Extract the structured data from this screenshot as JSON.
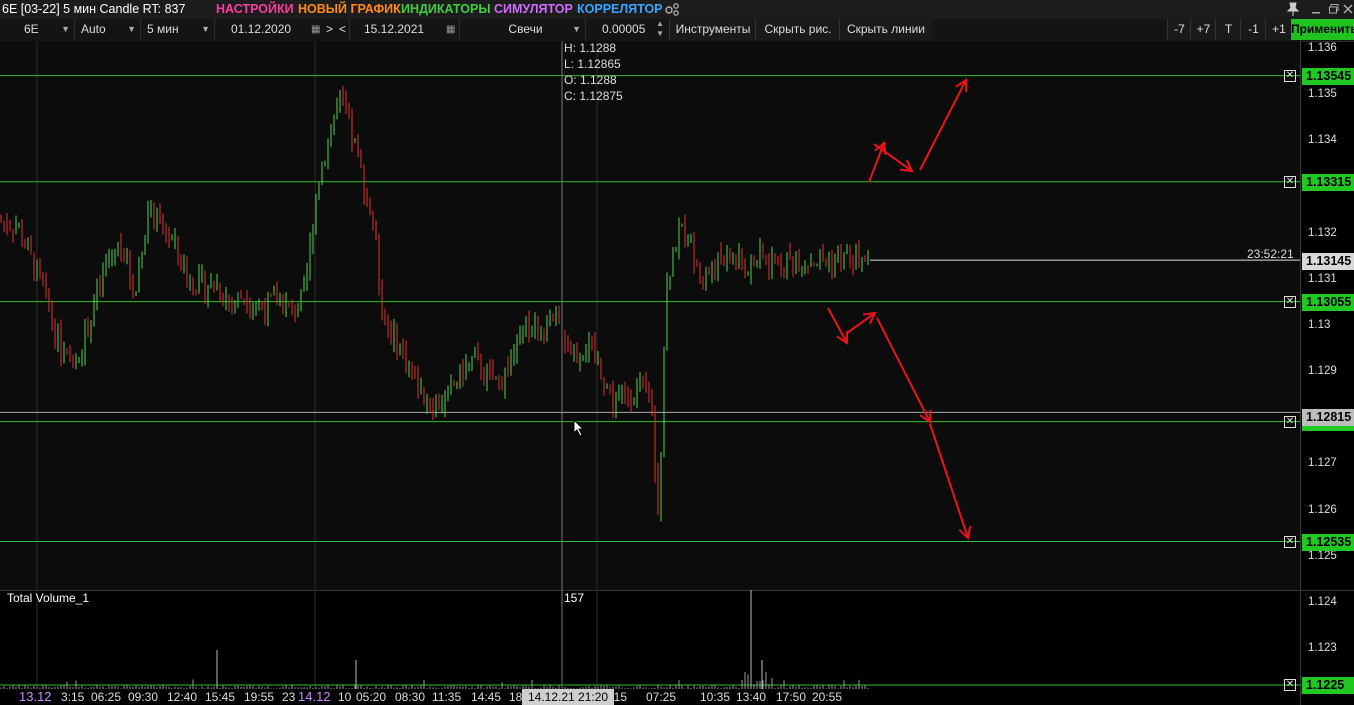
{
  "titlebar": {
    "title": "6E [03-22] 5 мин Candle RT: 837",
    "menu": [
      {
        "label": "НАСТРОЙКИ",
        "color": "#ff3aa0"
      },
      {
        "label": "НОВЫЙ ГРАФИК",
        "color": "#ff8a1a"
      },
      {
        "label": "ИНДИКАТОРЫ",
        "color": "#3ecf3e"
      },
      {
        "label": "СИМУЛЯТОР",
        "color": "#d06bff"
      },
      {
        "label": "КОРРЕЛЯТОР",
        "color": "#3aa6ff"
      }
    ],
    "pin_icon": "pin-icon",
    "window_controls": [
      "minimize-icon",
      "restore-icon",
      "close-icon"
    ]
  },
  "toolbar": {
    "symbol": "6E",
    "scale": "Auto",
    "timeframe": "5 мин",
    "date_from": "01.12.2020",
    "nav_next": ">",
    "nav_prev": "<",
    "date_to": "15.12.2021",
    "chart_type": "Свечи",
    "tick_size": "0.00005",
    "tools": "Инструменты",
    "hide_drawings": "Скрыть рис.",
    "hide_lines": "Скрыть линии",
    "btn_minus7": "-7",
    "btn_plus7": "+7",
    "btn_t": "T",
    "btn_minus1": "-1",
    "btn_plus1": "+1",
    "apply": "Применить"
  },
  "chart_data": {
    "type": "candlestick",
    "ylim": [
      1.1243,
      1.1362
    ],
    "y_ticks": [
      "1.136",
      "1.135",
      "1.134",
      "1.132",
      "1.131",
      "1.13",
      "1.129",
      "1.127",
      "1.126",
      "1.125",
      "1.124",
      "1.123"
    ],
    "x_labels": [
      {
        "text": "13.12",
        "highlight": true
      },
      {
        "text": "3:15"
      },
      {
        "text": "06:25"
      },
      {
        "text": "09:30"
      },
      {
        "text": "12:40"
      },
      {
        "text": "15:45"
      },
      {
        "text": "19:55"
      },
      {
        "text": "23"
      },
      {
        "text": "14.12",
        "highlight": true
      },
      {
        "text": "10"
      },
      {
        "text": "05:20"
      },
      {
        "text": "08:30"
      },
      {
        "text": "11:35"
      },
      {
        "text": "14:45"
      },
      {
        "text": "18"
      },
      {
        "text": "04:15"
      },
      {
        "text": "07:25"
      },
      {
        "text": "10:35"
      },
      {
        "text": "13:40"
      },
      {
        "text": "17:50"
      },
      {
        "text": "20:55"
      }
    ],
    "crosshair_time": "14.12.21 21:20",
    "ohlc": {
      "high": "H: 1.1288",
      "low": "L: 1.12865",
      "open": "O: 1.1288",
      "close": "C: 1.12875"
    },
    "current_price": "1.13145",
    "countdown": "23:52:21",
    "cursor_price": "1.12815",
    "levels": [
      {
        "price": 1.13545,
        "label": "1.13545"
      },
      {
        "price": 1.13315,
        "label": "1.13315"
      },
      {
        "price": 1.13055,
        "label": "1.13055"
      },
      {
        "price": 1.12795,
        "label": "1.12795"
      },
      {
        "price": 1.12535,
        "label": "1.12535"
      },
      {
        "price": 1.1225,
        "label": "1.1225"
      }
    ],
    "close_path": [
      [
        0,
        1.1323
      ],
      [
        0.02,
        1.1322
      ],
      [
        0.035,
        1.1315
      ],
      [
        0.05,
        1.1308
      ],
      [
        0.065,
        1.1298
      ],
      [
        0.08,
        1.1291
      ],
      [
        0.095,
        1.1296
      ],
      [
        0.11,
        1.1306
      ],
      [
        0.125,
        1.1315
      ],
      [
        0.14,
        1.1318
      ],
      [
        0.155,
        1.1307
      ],
      [
        0.17,
        1.1325
      ],
      [
        0.185,
        1.1322
      ],
      [
        0.2,
        1.1318
      ],
      [
        0.215,
        1.1311
      ],
      [
        0.23,
        1.1309
      ],
      [
        0.25,
        1.1309
      ],
      [
        0.265,
        1.1305
      ],
      [
        0.28,
        1.1307
      ],
      [
        0.3,
        1.1304
      ],
      [
        0.32,
        1.1306
      ],
      [
        0.335,
        1.1303
      ],
      [
        0.35,
        1.1307
      ],
      [
        0.365,
        1.1331
      ],
      [
        0.38,
        1.1343
      ],
      [
        0.39,
        1.1349
      ],
      [
        0.4,
        1.1344
      ],
      [
        0.41,
        1.1338
      ],
      [
        0.42,
        1.1329
      ],
      [
        0.43,
        1.1322
      ],
      [
        0.44,
        1.1302
      ],
      [
        0.455,
        1.1297
      ],
      [
        0.47,
        1.1292
      ],
      [
        0.485,
        1.1285
      ],
      [
        0.5,
        1.1283
      ],
      [
        0.515,
        1.1285
      ],
      [
        0.53,
        1.129
      ],
      [
        0.545,
        1.1293
      ],
      [
        0.56,
        1.1289
      ],
      [
        0.575,
        1.1288
      ],
      [
        0.59,
        1.1294
      ],
      [
        0.605,
        1.13
      ],
      [
        0.62,
        1.1299
      ],
      [
        0.64,
        1.1301
      ],
      [
        0.66,
        1.1294
      ],
      [
        0.675,
        1.1296
      ],
      [
        0.69,
        1.1291
      ],
      [
        0.705,
        1.1284
      ],
      [
        0.72,
        1.1285
      ],
      [
        0.735,
        1.1287
      ],
      [
        0.75,
        1.1283
      ],
      [
        0.755,
        1.1257
      ],
      [
        0.76,
        1.1276
      ],
      [
        0.765,
        1.1308
      ],
      [
        0.775,
        1.1318
      ],
      [
        0.79,
        1.1322
      ],
      [
        0.8,
        1.1313
      ],
      [
        0.81,
        1.1311
      ],
      [
        0.825,
        1.1314
      ],
      [
        0.84,
        1.1315
      ],
      [
        0.855,
        1.1313
      ],
      [
        0.87,
        1.13145
      ]
    ],
    "volume": {
      "label": "Total Volume_1",
      "crosshair_value": "157",
      "ylim": [
        0,
        160
      ]
    }
  }
}
